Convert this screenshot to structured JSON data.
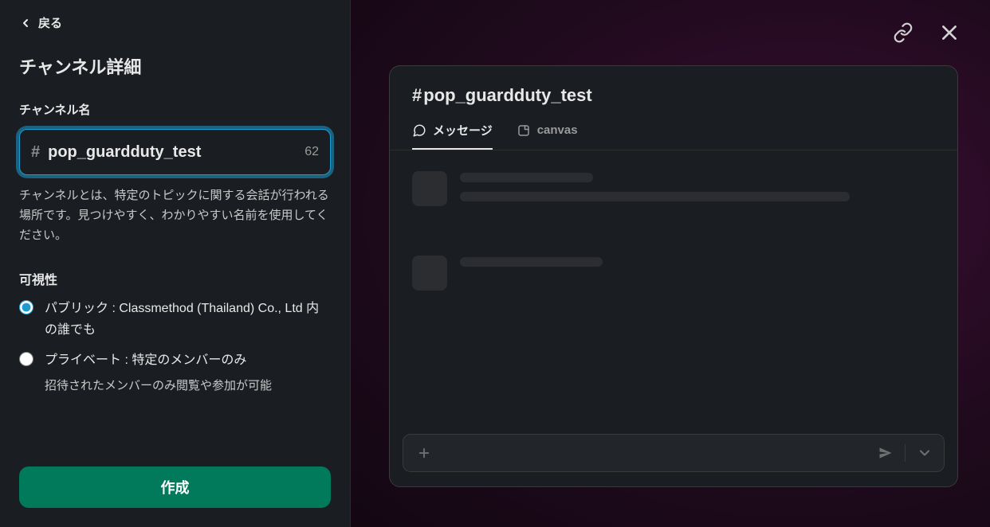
{
  "sidebar": {
    "back_label": "戻る",
    "title": "チャンネル詳細",
    "name_label": "チャンネル名",
    "name_value": "pop_guardduty_test",
    "name_remaining": "62",
    "name_help": "チャンネルとは、特定のトピックに関する会話が行われる場所です。見つけやすく、わかりやすい名前を使用してください。",
    "visibility_label": "可視性",
    "public_label": "パブリック : Classmethod (Thailand) Co., Ltd 内の誰でも",
    "private_label": "プライベート : 特定のメンバーのみ",
    "private_sub": "招待されたメンバーのみ閲覧や参加が可能",
    "create_label": "作成"
  },
  "preview": {
    "channel_name": "pop_guardduty_test",
    "tab_messages": "メッセージ",
    "tab_canvas": "canvas"
  }
}
